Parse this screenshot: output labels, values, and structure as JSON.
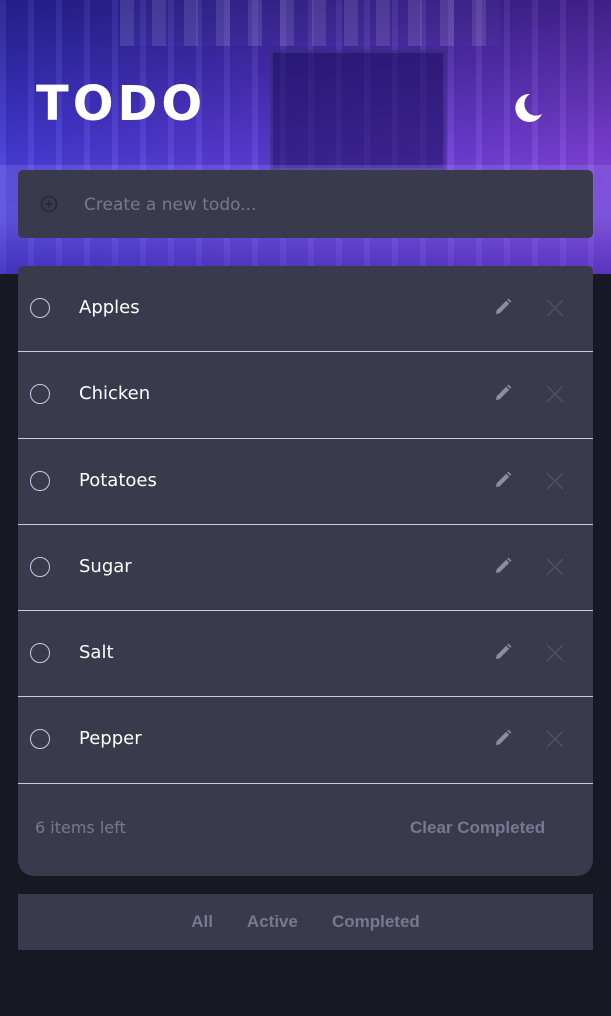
{
  "header": {
    "title": "TODO",
    "theme_icon": "moon-icon"
  },
  "new_todo": {
    "placeholder": "Create a new todo...",
    "value": "",
    "icon": "add-circle-icon"
  },
  "todos": [
    {
      "label": "Apples",
      "completed": false
    },
    {
      "label": "Chicken",
      "completed": false
    },
    {
      "label": "Potatoes",
      "completed": false
    },
    {
      "label": "Sugar",
      "completed": false
    },
    {
      "label": "Salt",
      "completed": false
    },
    {
      "label": "Pepper",
      "completed": false
    }
  ],
  "item_icons": {
    "check": "check-circle-icon",
    "edit": "pencil-icon",
    "delete": "close-icon"
  },
  "footer": {
    "items_left": "6 items left",
    "clear_completed": "Clear Completed"
  },
  "filters": {
    "all": "All",
    "active": "Active",
    "completed": "Completed"
  },
  "colors": {
    "background": "#171823",
    "card": "#393a4c",
    "text": "#ffffff",
    "muted": "#767992",
    "divider": "#c8cbe7",
    "gradient_start": "#3a3ad8",
    "gradient_end": "#8a42d8"
  }
}
